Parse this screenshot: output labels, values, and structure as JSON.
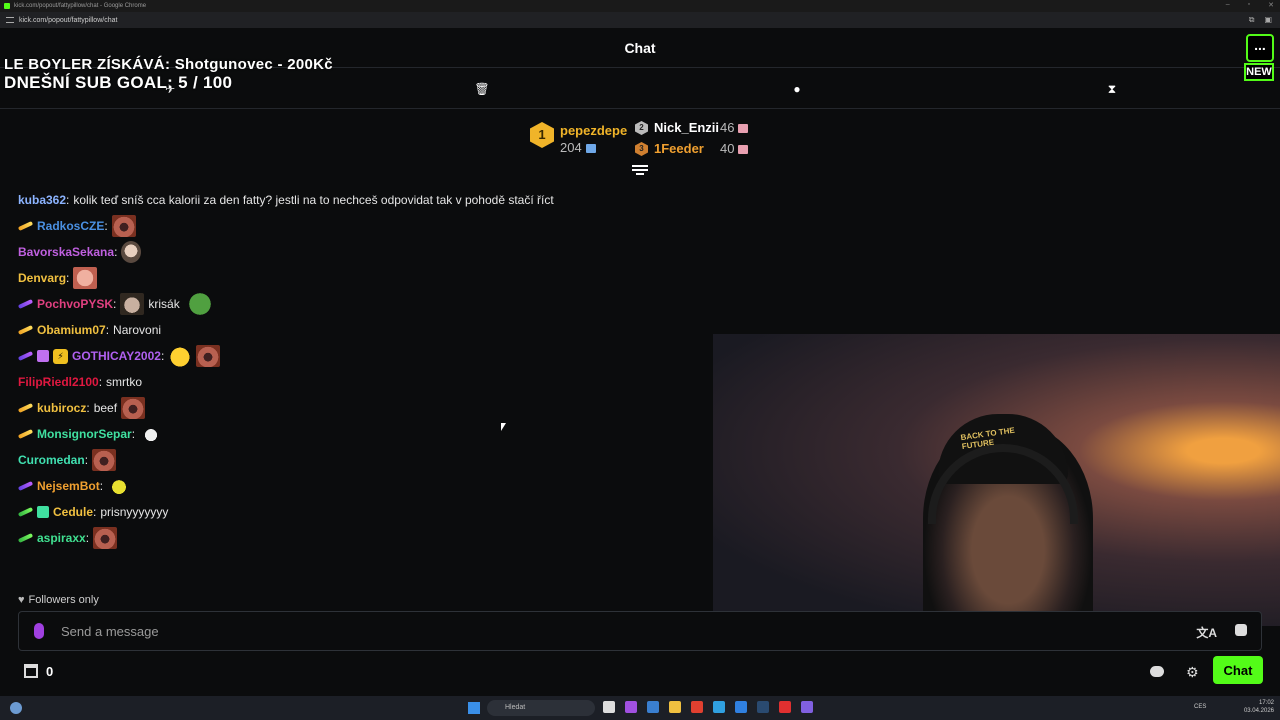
{
  "browser": {
    "window_title": "kick.com/popout/fattypillow/chat - Google Chrome",
    "url": "kick.com/popout/fattypillow/chat"
  },
  "header": {
    "title": "Chat",
    "menu_label": "...",
    "new_label": "NEW"
  },
  "overlay": {
    "line1": "LE BOYLER ZÍSKÁVÁ: Shotgunovec - 200Kč",
    "line2": "DNEŠNÍ SUB GOAL:  5 / 100"
  },
  "leaderboard": {
    "first": {
      "rank": "1",
      "name": "pepezdepe",
      "count": "204"
    },
    "second": {
      "rank": "2",
      "name": "Nick_Enzii",
      "count": "46"
    },
    "third": {
      "rank": "3",
      "name": "1Feeder",
      "count": "40"
    }
  },
  "messages": [
    {
      "name": "kuba362",
      "color": "#8cb4ff",
      "text": "kolik teď sníš cca kalorii za den fatty? jestli na to nechceš odpovidat tak v pohodě stačí říct"
    },
    {
      "name": "RadkosCZE",
      "color": "#4a90e2",
      "text": ""
    },
    {
      "name": "BavorskaSekana",
      "color": "#c060e0",
      "text": ""
    },
    {
      "name": "Denvarg",
      "color": "#f0c040",
      "text": ""
    },
    {
      "name": "PochvoPYSK",
      "color": "#e04080",
      "text": "krisák"
    },
    {
      "name": "Obamium07",
      "color": "#f0c040",
      "text": "Narovoni"
    },
    {
      "name": "GOTHICAY2002",
      "color": "#b060f0",
      "text": ""
    },
    {
      "name": "FilipRiedl2100",
      "color": "#e01840",
      "text": "smrtko"
    },
    {
      "name": "kubirocz",
      "color": "#f0c040",
      "text": "beef"
    },
    {
      "name": "MonsignorSepar",
      "color": "#40e0a0",
      "text": ""
    },
    {
      "name": "Curomedan",
      "color": "#40e0b0",
      "text": ""
    },
    {
      "name": "NejsemBot",
      "color": "#f0a030",
      "text": ""
    },
    {
      "name": "Cedule",
      "color": "#f0c040",
      "text": "prisnyyyyyyy"
    },
    {
      "name": "aspiraxx",
      "color": "#40e090",
      "text": ""
    }
  ],
  "followers_only": "Followers only",
  "input": {
    "placeholder": "Send a message"
  },
  "bottom": {
    "shop_count": "0",
    "chat_button": "Chat"
  },
  "stream_overlay": {
    "cap_text": "BACK TO THE FUTURE"
  },
  "taskbar": {
    "search_placeholder": "Hledat",
    "lang": "CES",
    "time": "17:02",
    "date": "03.04.2026"
  },
  "colors": {
    "accent": "#53fc18",
    "gold": "#f0b429"
  }
}
